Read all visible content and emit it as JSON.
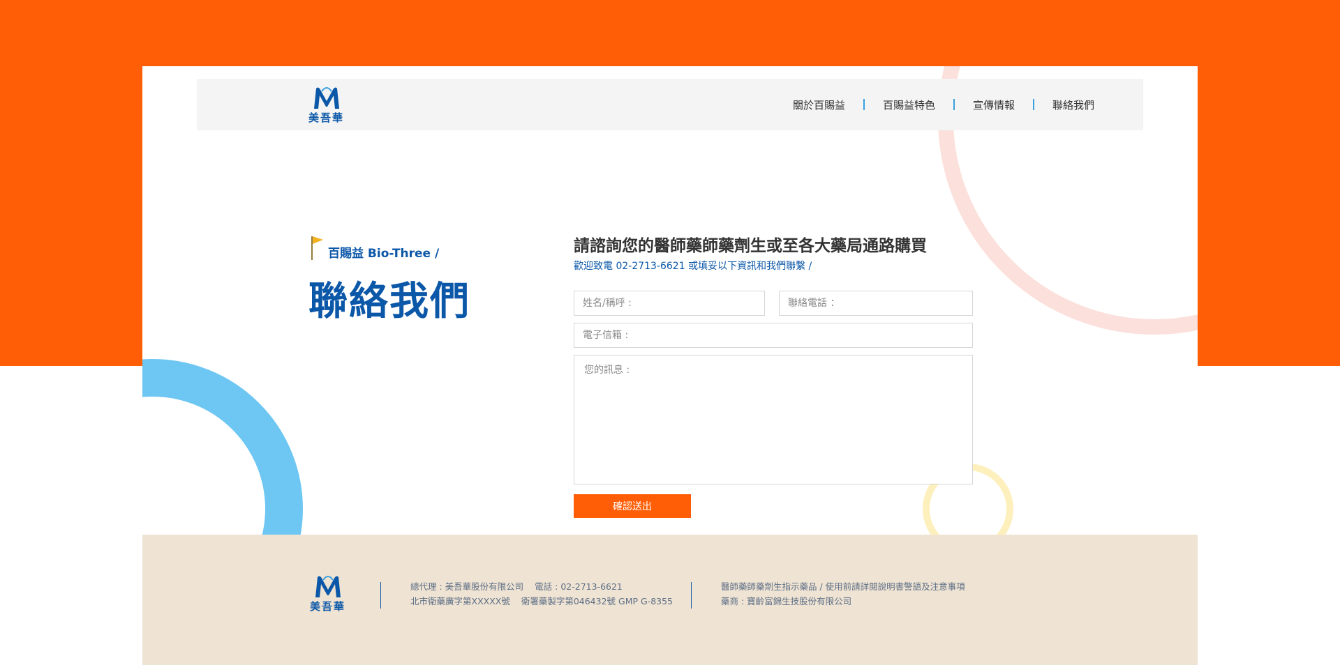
{
  "brand": {
    "logo_text": "美吾華",
    "color_primary": "#0b57a8",
    "color_accent": "#ff5e06"
  },
  "nav": {
    "items": [
      {
        "label": "關於百賜益"
      },
      {
        "label": "百賜益特色"
      },
      {
        "label": "宣傳情報"
      },
      {
        "label": "聯絡我們"
      }
    ]
  },
  "hero": {
    "eyebrow": "百賜益 Bio-Three /",
    "title": "聯絡我們"
  },
  "form": {
    "title": "請諮詢您的醫師藥師藥劑生或至各大藥局通路購買",
    "subtitle": "歡迎致電 02-2713-6621 或填妥以下資訊和我們聯繫 /",
    "name_placeholder": "姓名/稱呼 :",
    "phone_placeholder": "聯絡電話 ：",
    "email_placeholder": "電子信箱 :",
    "message_placeholder": "您的訊息 :",
    "submit_label": "確認送出"
  },
  "footer": {
    "agent": "總代理 : 美吾華股份有限公司",
    "phone": "電話 : 02-2713-6621",
    "license_1": "北市衛藥廣字第XXXXX號",
    "license_2": "衛署藥製字第046432號 GMP G-8355",
    "notice": "醫師藥師藥劑生指示藥品 / 使用前請詳閱說明書警語及注意事項",
    "manufacturer": "藥商 : 寶齡富錦生技股份有限公司"
  }
}
